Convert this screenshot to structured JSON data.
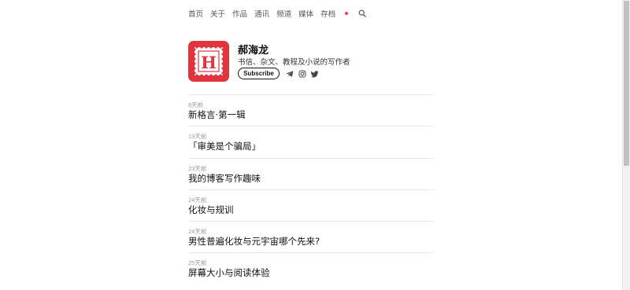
{
  "nav": {
    "items": [
      "首页",
      "关于",
      "作品",
      "通讯",
      "频道",
      "媒体",
      "存档"
    ],
    "icons": [
      "japan-flag-icon",
      "search-icon"
    ]
  },
  "profile": {
    "logo_letter": "H",
    "name": "郝海龙",
    "tagline": "书信、杂文、教程及小说的写作者",
    "subscribe_label": "Subscribe",
    "social_icons": [
      "telegram-icon",
      "instagram-icon",
      "twitter-icon"
    ],
    "brand_color": "#e0353d"
  },
  "posts": [
    {
      "date": "8天前",
      "title": "新格言·第一辑"
    },
    {
      "date": "13天前",
      "title": "「审美是个骗局」"
    },
    {
      "date": "23天前",
      "title": "我的博客写作趣味"
    },
    {
      "date": "24天前",
      "title": "化妆与规训"
    },
    {
      "date": "24天前",
      "title": "男性普遍化妆与元宇宙哪个先来?"
    },
    {
      "date": "25天前",
      "title": "屏幕大小与阅读体验"
    }
  ]
}
